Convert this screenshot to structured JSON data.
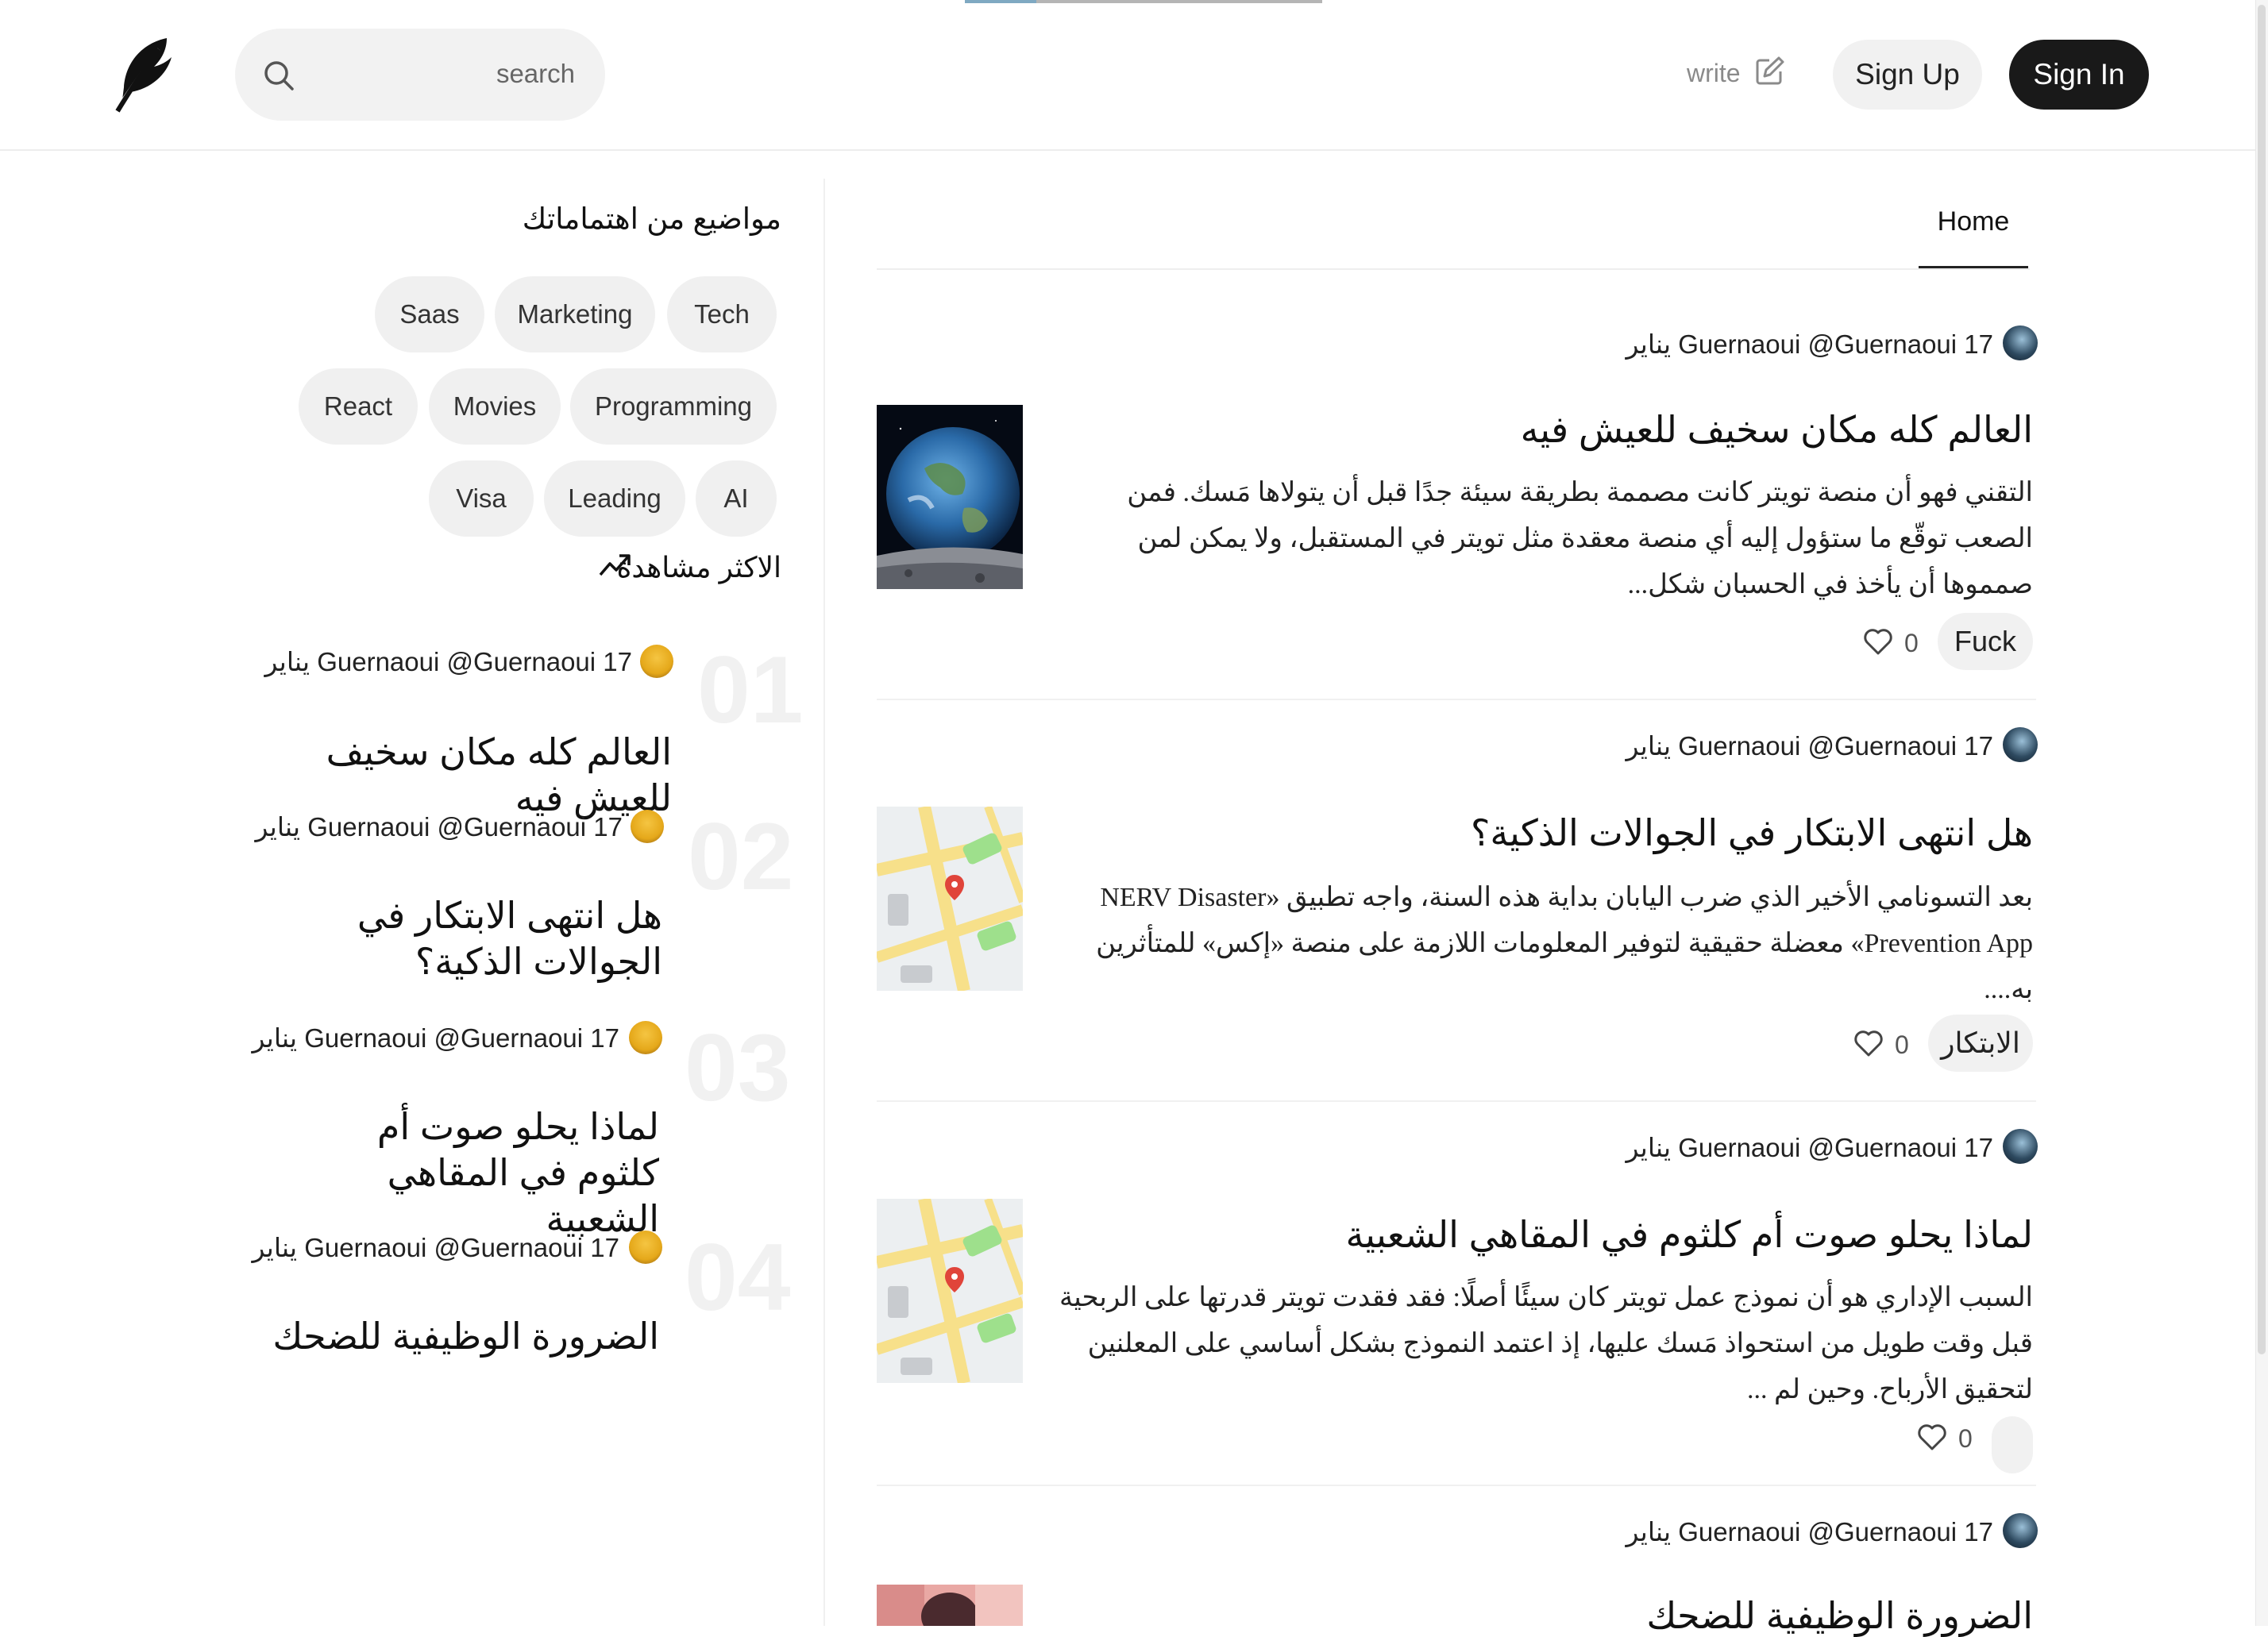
{
  "loading": {
    "progress": 0.2
  },
  "header": {
    "logo": "feather-logo",
    "search": {
      "placeholder": "search"
    },
    "write_label": "write",
    "signup_label": "Sign Up",
    "signin_label": "Sign In"
  },
  "sidebar": {
    "topics_title": "مواضيع من اهتماماتك",
    "topics": [
      "Tech",
      "Marketing",
      "Saas",
      "Programming",
      "Movies",
      "React",
      "AI",
      "Leading",
      "Visa"
    ],
    "trending_title": "الاكثر مشاهدة",
    "trending": [
      {
        "number": "01",
        "author": "Guernaoui @Guernaoui",
        "date": "17 يناير",
        "title": "العالم كله مكان سخيف للعيش فيه"
      },
      {
        "number": "02",
        "author": "Guernaoui @Guernaoui",
        "date": "17 يناير",
        "title": "هل انتهى الابتكار في الجوالات الذكية؟"
      },
      {
        "number": "03",
        "author": "Guernaoui @Guernaoui",
        "date": "17 يناير",
        "title": "لماذا يحلو صوت أم كلثوم في المقاهي الشعبية"
      },
      {
        "number": "04",
        "author": "Guernaoui @Guernaoui",
        "date": "17 يناير",
        "title": "الضرورة الوظيفية للضحك"
      }
    ]
  },
  "main": {
    "tabs": [
      {
        "label": "Home",
        "active": true
      }
    ],
    "posts": [
      {
        "author": "Guernaoui @Guernaoui",
        "date": "17 يناير",
        "title": "العالم كله مكان سخيف للعيش فيه",
        "excerpt": "التقني فهو أن منصة تويتر كانت مصممة بطريقة سيئة جدًا قبل أن يتولاها مَسك. فمن الصعب توقّع ما ستؤول إليه أي منصة معقدة مثل تويتر في المستقبل، ولا يمكن لمن صمموها أن يأخذ في الحسبان شكل...",
        "thumbnail": "earth-image",
        "tag": "Fuck",
        "likes": "0"
      },
      {
        "author": "Guernaoui @Guernaoui",
        "date": "17 يناير",
        "title": "هل انتهى الابتكار في الجوالات الذكية؟",
        "excerpt": "بعد التسونامي الأخير الذي ضرب اليابان بداية هذه السنة، واجه تطبيق «NERV Disaster Prevention App» معضلة حقيقية لتوفير المعلومات اللازمة على منصة «إكس» للمتأثرين به....",
        "thumbnail": "map-image",
        "tag": "الابتكار",
        "likes": "0"
      },
      {
        "author": "Guernaoui @Guernaoui",
        "date": "17 يناير",
        "title": "لماذا يحلو صوت أم كلثوم في المقاهي الشعبية",
        "excerpt": "السبب الإداري هو أن نموذج عمل تويتر كان سيئًا أصلًا: فقد فقدت تويتر قدرتها على الربحية قبل وقت طويل من استحواذ مَسك عليها، إذ اعتمد النموذج بشكل أساسي على المعلنين لتحقيق الأرباح. وحين لم ...",
        "thumbnail": "map-image",
        "tag": "",
        "likes": "0"
      },
      {
        "author": "Guernaoui @Guernaoui",
        "date": "17 يناير",
        "title": "الضرورة الوظيفية للضحك",
        "thumbnail": "portrait-image"
      }
    ]
  },
  "colors": {
    "accent_dark": "#191919",
    "chip_bg": "#f0f0f0",
    "map_road": "#f7e08a",
    "map_green": "#9ee08c",
    "pin": "#e0443a"
  }
}
